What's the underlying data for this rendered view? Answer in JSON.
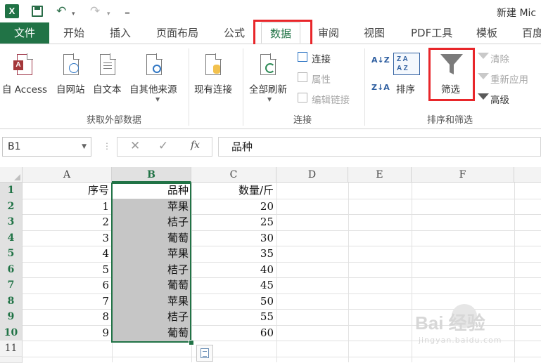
{
  "app": {
    "logo_text": "X",
    "title": "新建 Mic"
  },
  "quick_access": {
    "undo_icon": "undo-icon",
    "redo_icon": "redo-icon",
    "save_icon": "save-icon"
  },
  "ribbon_tabs": {
    "file": "文件",
    "items": [
      "开始",
      "插入",
      "页面布局",
      "公式",
      "数据",
      "审阅",
      "视图",
      "PDF工具",
      "模板",
      "百度"
    ],
    "active": "数据"
  },
  "ribbon": {
    "get_external": {
      "access": "自 Access",
      "web": "自网站",
      "text": "自文本",
      "other": "自其他来源",
      "existing": "现有连接",
      "group_label": "获取外部数据"
    },
    "connections": {
      "refresh_all": "全部刷新",
      "connections": "连接",
      "properties": "属性",
      "edit_links": "编辑链接",
      "group_label": "连接"
    },
    "sort_filter": {
      "sort_az": "A↓Z",
      "sort_za": "Z↓A",
      "sort": "排序",
      "filter": "筛选",
      "clear": "清除",
      "reapply": "重新应用",
      "advanced": "高级",
      "group_label": "排序和筛选"
    }
  },
  "formula_bar": {
    "name_box": "B1",
    "fx": "fx",
    "value": "品种"
  },
  "sheet": {
    "columns": [
      "A",
      "B",
      "C",
      "D",
      "E",
      "F"
    ],
    "rows": [
      "1",
      "2",
      "3",
      "4",
      "5",
      "6",
      "7",
      "8",
      "9",
      "10",
      "11"
    ],
    "col_a": [
      "序号",
      "1",
      "2",
      "3",
      "4",
      "5",
      "6",
      "7",
      "8",
      "9"
    ],
    "col_b": [
      "品种",
      "苹果",
      "桔子",
      "葡萄",
      "苹果",
      "桔子",
      "葡萄",
      "苹果",
      "桔子",
      "葡萄"
    ],
    "col_c": [
      "数量/斤",
      "20",
      "25",
      "30",
      "35",
      "40",
      "45",
      "50",
      "55",
      "60"
    ],
    "selected_range": "B1:B10"
  },
  "watermark": {
    "text": "Bai 经验",
    "sub": "jingyan.baidu.com"
  },
  "colors": {
    "accent": "#217346",
    "highlight_box": "#e8262a",
    "selection_fill": "#c6c6c6"
  }
}
